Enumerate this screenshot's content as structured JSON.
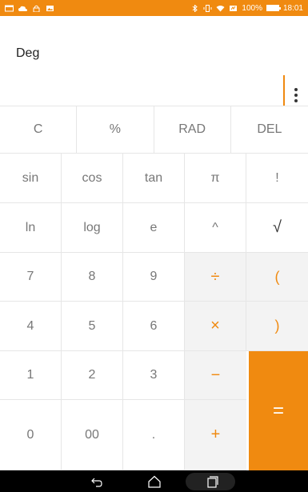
{
  "status_bar": {
    "battery_text": "100%",
    "time": "18:01",
    "icons": [
      "card-icon",
      "cloud-upload-icon",
      "lock-icon",
      "image-icon",
      "bluetooth-icon",
      "vibrate-icon",
      "wifi-icon",
      "battery-saver-icon",
      "battery-icon"
    ]
  },
  "display": {
    "mode": "Deg",
    "menu_icon": "more-vert-icon"
  },
  "keypad": {
    "top_row": [
      "C",
      "%",
      "RAD",
      "DEL"
    ],
    "sci_row1": [
      "sin",
      "cos",
      "tan",
      "π",
      "!"
    ],
    "sci_row2": [
      "ln",
      "log",
      "e",
      "^",
      "√"
    ],
    "num_row1": [
      "7",
      "8",
      "9",
      "÷",
      "("
    ],
    "num_row2": [
      "4",
      "5",
      "6",
      "×",
      ")"
    ],
    "num_row3": [
      "1",
      "2",
      "3",
      "−"
    ],
    "num_row4": [
      "0",
      "00",
      ".",
      "+"
    ],
    "equals": "="
  },
  "nav_bar": {
    "icons": [
      "back-icon",
      "home-icon",
      "recent-apps-icon"
    ]
  },
  "colors": {
    "accent": "#f08a10",
    "key_text": "#777777",
    "operator_bg": "#f3f3f3"
  }
}
